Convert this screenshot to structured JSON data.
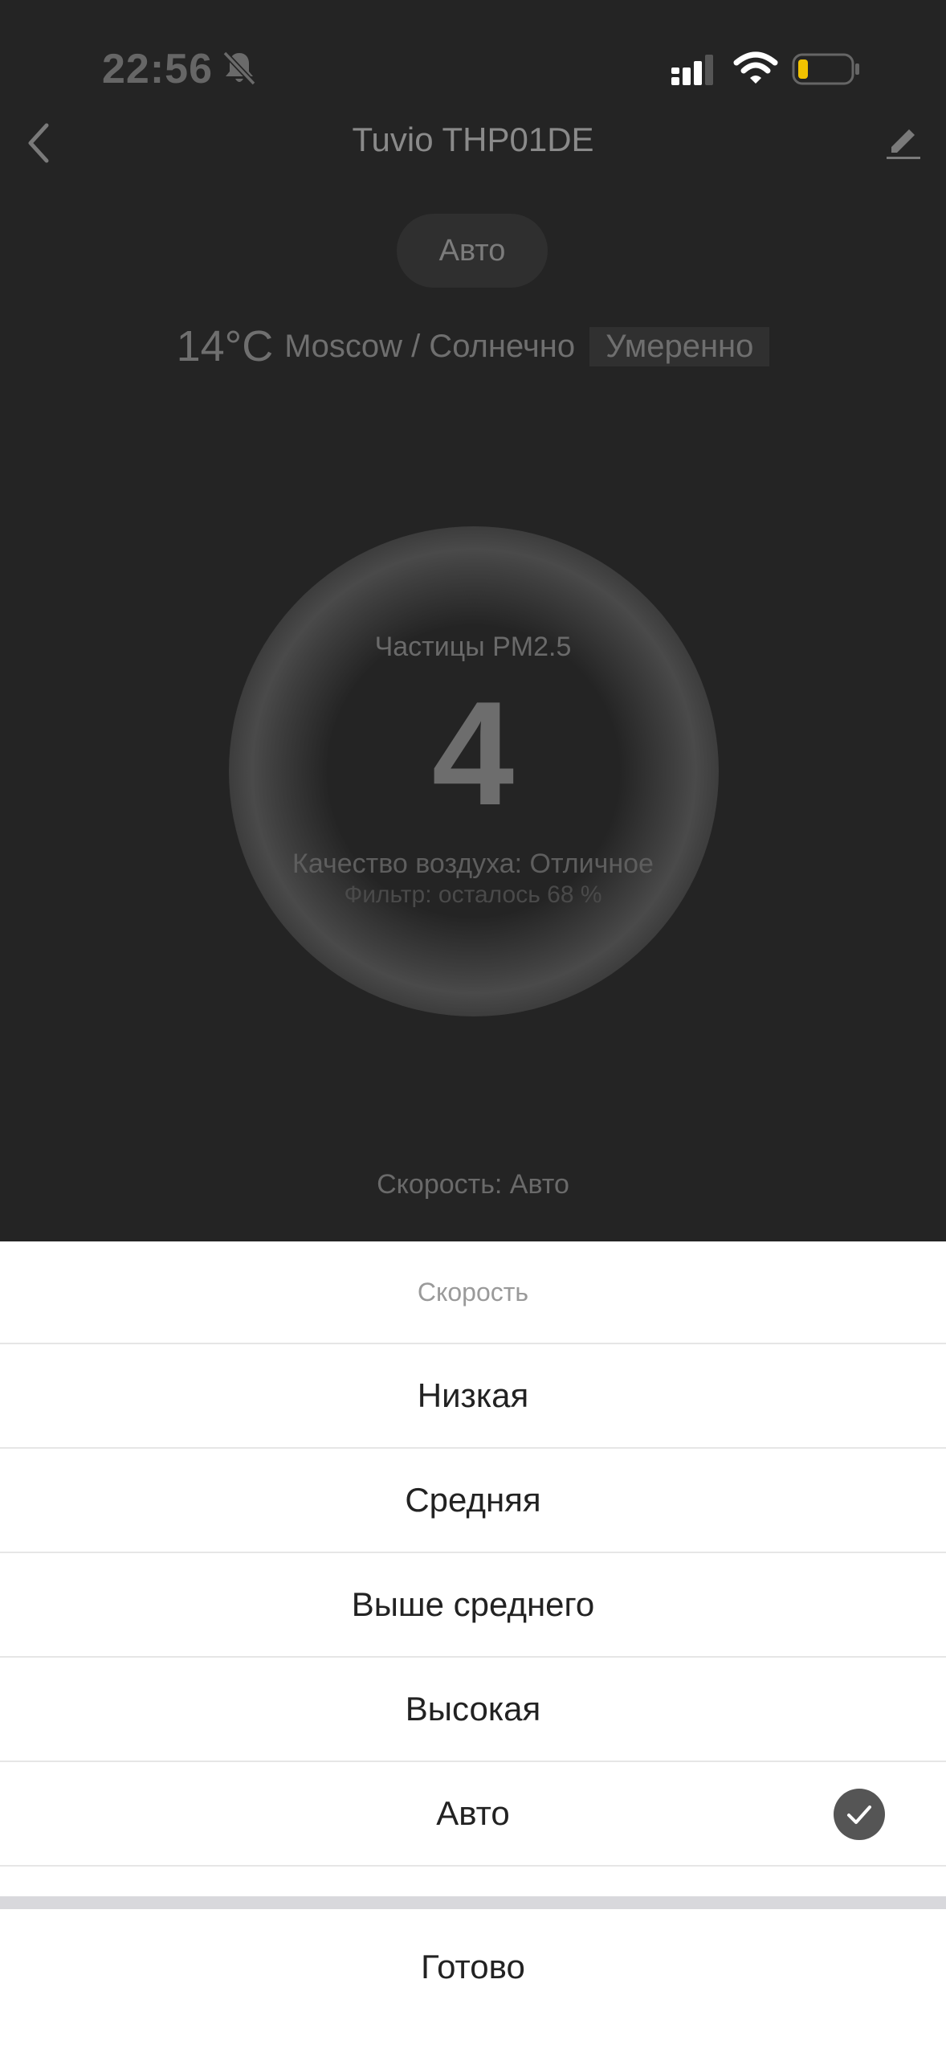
{
  "status_bar": {
    "time": "22:56"
  },
  "header": {
    "title": "Tuvio THP01DE"
  },
  "mode": {
    "label": "Авто"
  },
  "weather": {
    "temperature": "14°C",
    "location_condition": "Moscow / Солнечно",
    "aqi": "Умеренно"
  },
  "sensor": {
    "label": "Частицы PM2.5",
    "value": "4",
    "quality": "Качество воздуха: Отличное",
    "filter": "Фильтр: осталось 68 %"
  },
  "speed_status": "Скорость: Авто",
  "sheet": {
    "title": "Скорость",
    "options": [
      {
        "label": "Низкая",
        "selected": false
      },
      {
        "label": "Средняя",
        "selected": false
      },
      {
        "label": "Выше среднего",
        "selected": false
      },
      {
        "label": "Высокая",
        "selected": false
      },
      {
        "label": "Авто",
        "selected": true
      }
    ],
    "done_label": "Готово"
  },
  "colors": {
    "battery_level": "#f2c200",
    "check_bg": "#555555"
  },
  "icons": [
    "bell-muted-icon",
    "cellular-signal-icon",
    "wifi-icon",
    "battery-icon",
    "back-chevron-icon",
    "pencil-edit-icon",
    "checkmark-icon"
  ]
}
